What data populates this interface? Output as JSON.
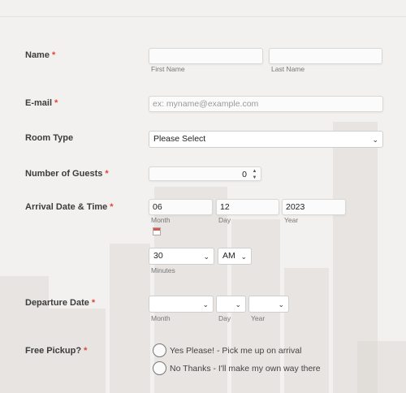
{
  "name_field": {
    "label": "Name",
    "required": "*",
    "first_value": "",
    "first_sublabel": "First Name",
    "last_value": "",
    "last_sublabel": "Last Name"
  },
  "email_field": {
    "label": "E-mail",
    "required": "*",
    "placeholder": "ex: myname@example.com"
  },
  "room_field": {
    "label": "Room Type",
    "selected": "Please Select",
    "icon": "chevron-down-icon"
  },
  "guests_field": {
    "label": "Number of Guests",
    "required": "*",
    "value": "0",
    "icon": "spinner-arrows-icon"
  },
  "arrival_field": {
    "label": "Arrival Date & Time",
    "required": "*",
    "month": "06",
    "month_sublabel": "Month",
    "day": "12",
    "day_sublabel": "Day",
    "year": "2023",
    "year_sublabel": "Year",
    "calendar_icon": "calendar-icon",
    "minutes": "30",
    "minutes_sublabel": "Minutes",
    "ampm": "AM"
  },
  "departure_field": {
    "label": "Departure Date",
    "required": "*",
    "month": "",
    "month_sublabel": "Month",
    "day": "",
    "day_sublabel": "Day",
    "year": "",
    "year_sublabel": "Year"
  },
  "pickup_field": {
    "label": "Free Pickup?",
    "required": "*",
    "options": [
      "Yes Please! - Pick me up on arrival",
      "No Thanks - I'll make my own way there"
    ]
  },
  "colors": {
    "required": "#e0443b",
    "label": "#3c3c3c",
    "background": "#f3f1ef"
  }
}
